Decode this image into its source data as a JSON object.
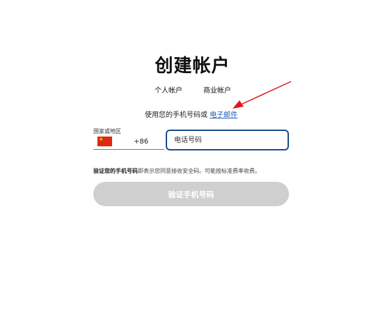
{
  "header": {
    "title": "创建帐户"
  },
  "tabs": [
    {
      "label": "个人帐户"
    },
    {
      "label": "商业帐户"
    }
  ],
  "signup_method": {
    "prompt": "使用您的手机号码或 ",
    "email_link": "电子邮件"
  },
  "phone_form": {
    "country_label": "国家或地区",
    "country_flag": "flag-china-icon",
    "dial_code": "+86",
    "phone_placeholder": "电话号码",
    "phone_value": ""
  },
  "notice": {
    "bold": "验证您的手机号码",
    "text": "即表示您同意接收安全码。可能按标准费率收费。"
  },
  "actions": {
    "verify_label": "验证手机号码"
  },
  "colors": {
    "link": "#1b5fb5",
    "input_border": "#1b4b8f",
    "button_disabled": "#cfcfcf",
    "annotation_arrow": "#e01818"
  }
}
